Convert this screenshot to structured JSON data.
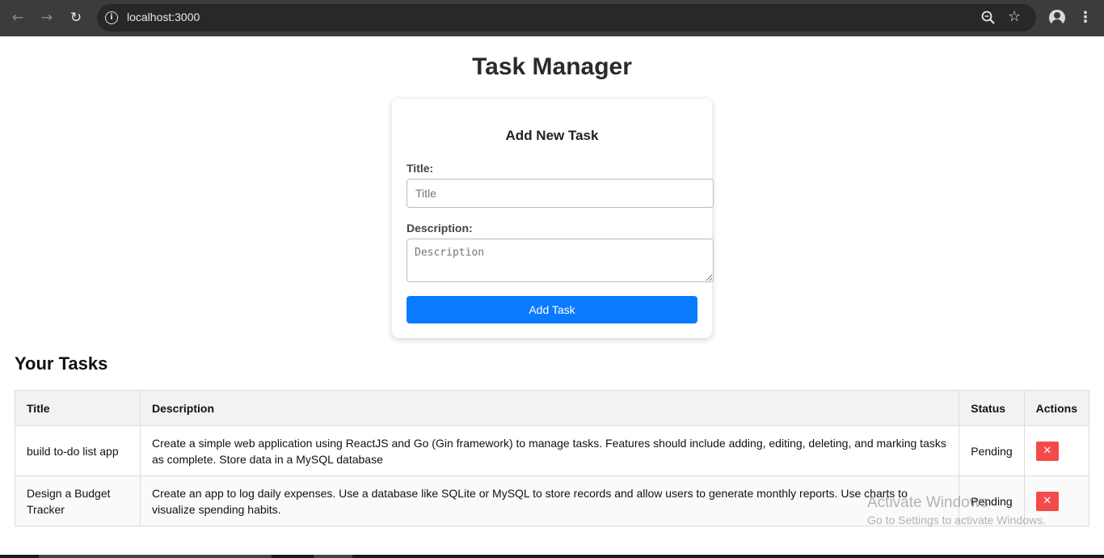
{
  "browser": {
    "url": "localhost:3000",
    "icons": {
      "back": "arrow-left-icon",
      "forward": "arrow-right-icon",
      "reload": "reload-icon",
      "info": "info-icon",
      "zoom": "zoom-icon",
      "bookmark": "star-icon",
      "menu": "kebab-menu-icon"
    }
  },
  "page": {
    "title": "Task Manager"
  },
  "form": {
    "heading": "Add New Task",
    "title_label": "Title:",
    "title_placeholder": "Title",
    "title_value": "",
    "description_label": "Description:",
    "description_placeholder": "Description",
    "description_value": "",
    "submit_label": "Add Task",
    "accent_color": "#0a7bff"
  },
  "tasks": {
    "heading": "Your Tasks",
    "columns": [
      "Title",
      "Description",
      "Status",
      "Actions"
    ],
    "rows": [
      {
        "title": "build to-do list app",
        "description": "Create a simple web application using ReactJS and Go (Gin framework) to manage tasks. Features should include adding, editing, deleting, and marking tasks as complete. Store data in a MySQL database",
        "status": "Pending",
        "delete_label": "✕"
      },
      {
        "title": "Design a Budget Tracker",
        "description": "Create an app to log daily expenses. Use a database like SQLite or MySQL to store records and allow users to generate monthly reports. Use charts to visualize spending habits.",
        "status": "Pending",
        "delete_label": "✕"
      }
    ],
    "delete_color": "#f44a4a"
  },
  "watermark": {
    "line1": "Activate Windows",
    "line2": "Go to Settings to activate Windows."
  }
}
